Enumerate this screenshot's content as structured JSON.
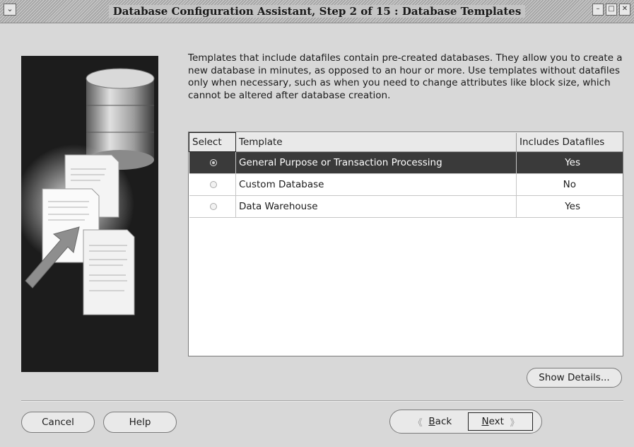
{
  "window": {
    "title": "Database Configuration Assistant, Step 2 of 15 : Database Templates",
    "menu_icon": "chevron-down-icon",
    "controls": [
      "minimize-icon",
      "maximize-icon",
      "close-icon"
    ]
  },
  "description": "Templates that include datafiles contain pre-created databases. They allow you to create a new database in minutes, as opposed to an hour or more. Use templates without datafiles only when necessary, such as when you need to change attributes like block size, which cannot be altered after database creation.",
  "templates_table": {
    "headers": [
      "Select",
      "Template",
      "Includes Datafiles"
    ],
    "rows": [
      {
        "selected": true,
        "template": "General Purpose or Transaction Processing",
        "includes_datafiles": "Yes"
      },
      {
        "selected": false,
        "template": "Custom Database",
        "includes_datafiles": "No"
      },
      {
        "selected": false,
        "template": "Data Warehouse",
        "includes_datafiles": "Yes"
      }
    ],
    "selected_row_color": "#3a3a3a"
  },
  "buttons": {
    "show_details": "Show Details...",
    "cancel": "Cancel",
    "help": "Help",
    "back_prefix": "",
    "back_mnemonic": "B",
    "back_rest": "ack",
    "next_mnemonic": "N",
    "next_rest": "ext"
  }
}
